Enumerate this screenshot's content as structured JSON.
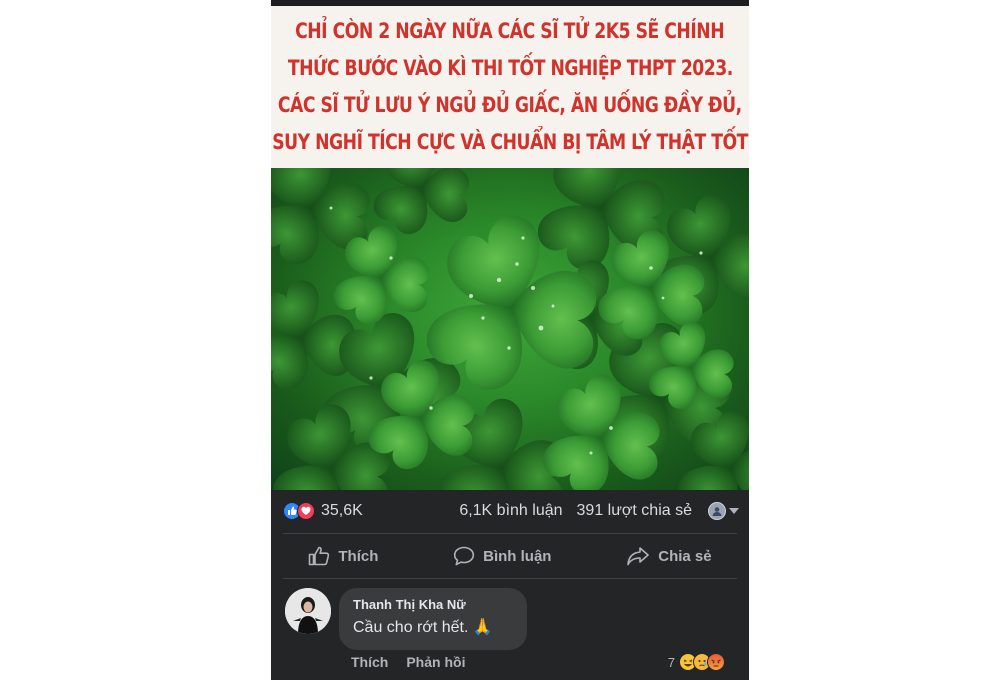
{
  "post": {
    "caption_lines": [
      "CHỈ CÒN 2 NGÀY NỮA CÁC SĨ TỬ 2K5 SẼ CHÍNH",
      "THỨC BƯỚC VÀO KÌ THI TỐT NGHIỆP THPT 2023.",
      "CÁC SĨ TỬ LƯU Ý NGỦ ĐỦ GIẤC, ĂN UỐNG ĐẦY ĐỦ,",
      "SUY NGHĨ TÍCH CỰC VÀ CHUẨN BỊ TÂM LÝ THẬT TỐT"
    ],
    "caption_color": "#d0332c"
  },
  "stats": {
    "reactions_count": "35,6K",
    "comments": "6,1K bình luận",
    "shares": "391 lượt chia sẻ"
  },
  "actions": {
    "like": "Thích",
    "comment": "Bình luận",
    "share": "Chia sẻ"
  },
  "comment": {
    "author": "Thanh Thị Kha Nữ",
    "text": "Cầu cho rớt hết. 🙏",
    "like_label": "Thích",
    "reply_label": "Phản hồi",
    "reaction_count": "7"
  },
  "icons": {
    "reactions": [
      "like-icon",
      "love-icon"
    ],
    "comment_reactions": [
      "haha-icon",
      "sad-icon",
      "angry-icon"
    ]
  },
  "colors": {
    "background": "#242526",
    "like_blue": "#2d88ff",
    "love_red": "#f33e58",
    "muted_text": "#b0b3b8"
  }
}
